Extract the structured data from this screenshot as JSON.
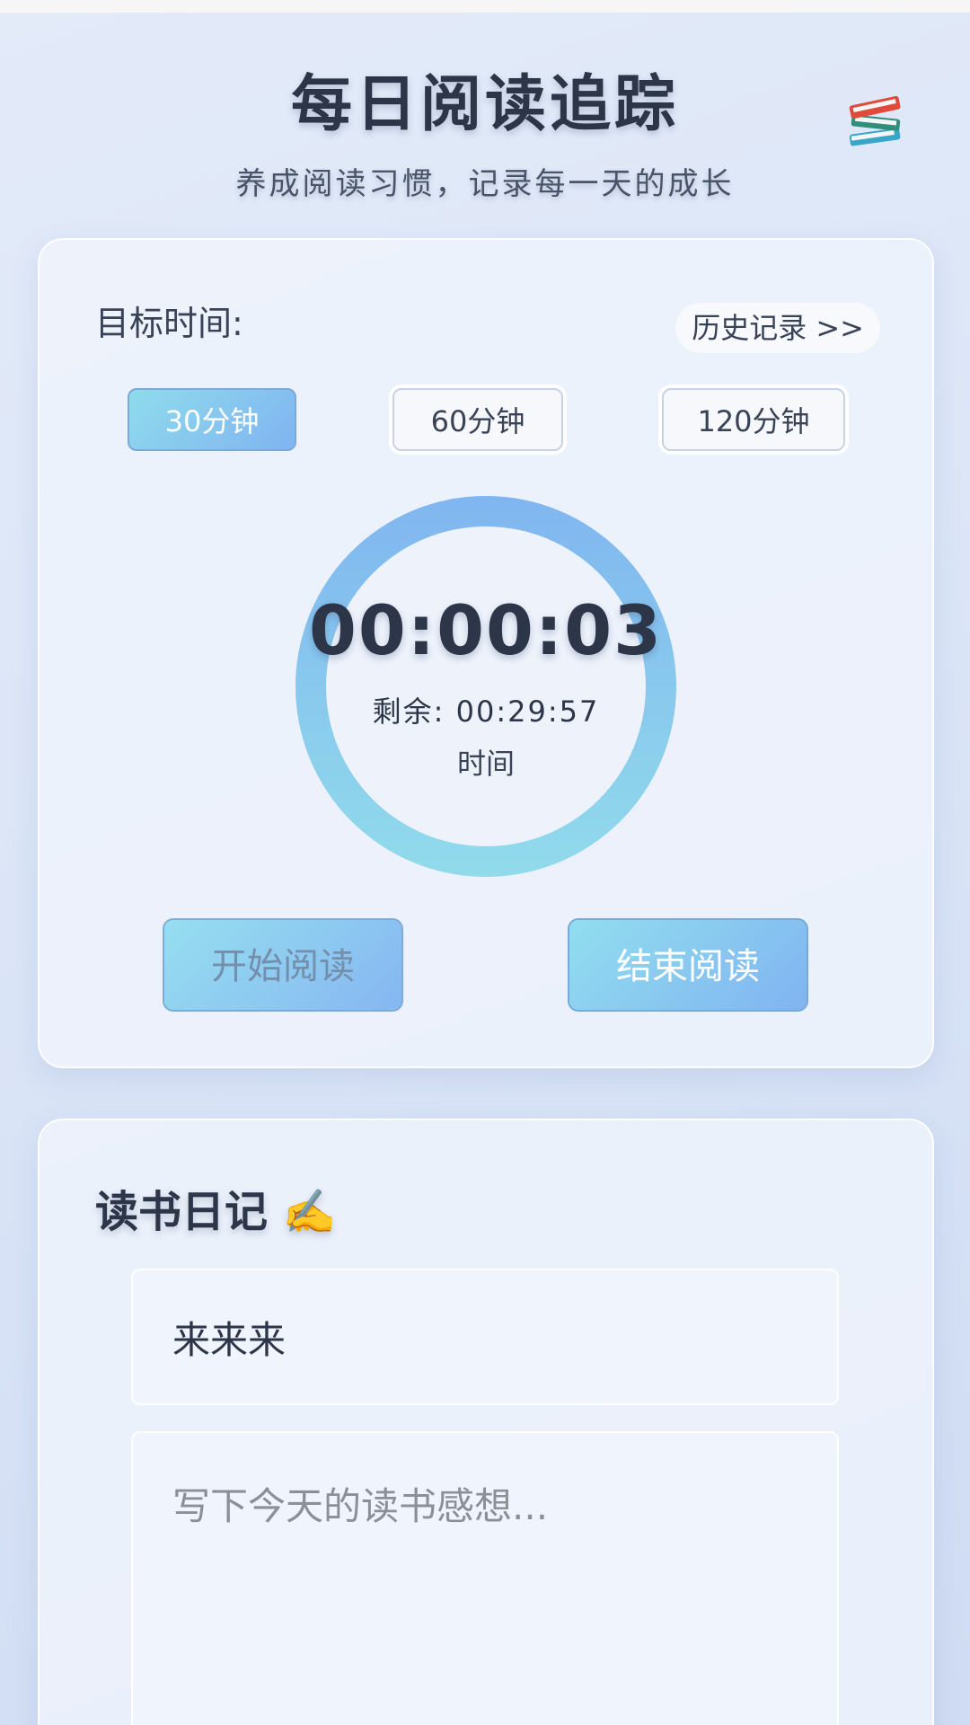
{
  "header": {
    "title": "每日阅读追踪",
    "subtitle": "养成阅读习惯，记录每一天的成长",
    "icon": "books-icon"
  },
  "timer_card": {
    "goal_label": "目标时间:",
    "history_link": "历史记录 >>",
    "goal_options": [
      {
        "label": "30分钟",
        "selected": true
      },
      {
        "label": "60分钟",
        "selected": false
      },
      {
        "label": "120分钟",
        "selected": false
      }
    ],
    "elapsed": "00:00:03",
    "remaining_label": "剩余:",
    "remaining_value": "00:29:57",
    "remaining_suffix": "时间",
    "start_button": "开始阅读",
    "end_button": "结束阅读"
  },
  "diary_card": {
    "title": "读书日记",
    "title_icon": "✍️",
    "book_title_value": "来来来",
    "notes_placeholder": "写下今天的读书感想..."
  },
  "colors": {
    "accent_start": "#92def0",
    "accent_end": "#80b4f1",
    "text_primary": "#2d3648"
  }
}
